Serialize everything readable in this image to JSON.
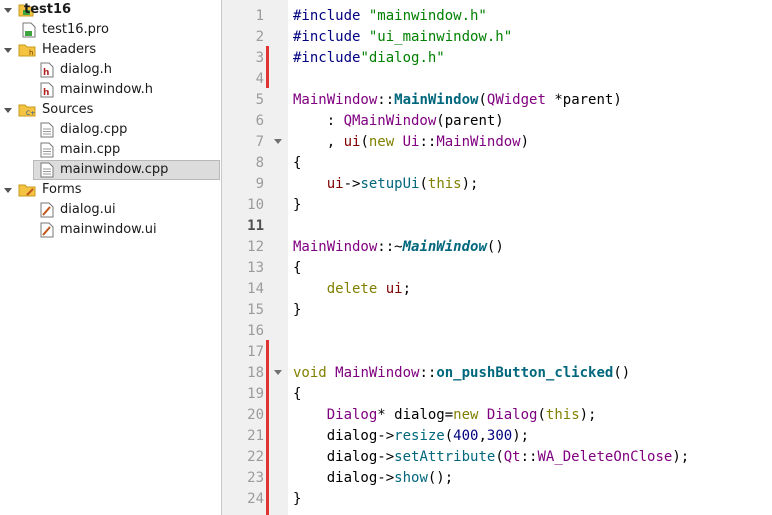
{
  "tree": {
    "project": "test16",
    "pro_file": "test16.pro",
    "headers": {
      "label": "Headers",
      "files": [
        "dialog.h",
        "mainwindow.h"
      ]
    },
    "sources": {
      "label": "Sources",
      "files": [
        "dialog.cpp",
        "main.cpp",
        "mainwindow.cpp"
      ]
    },
    "forms": {
      "label": "Forms",
      "files": [
        "dialog.ui",
        "mainwindow.ui"
      ]
    },
    "selected_file": "mainwindow.cpp"
  },
  "editor": {
    "current_line": 11,
    "line_numbers": [
      "1",
      "2",
      "3",
      "4",
      "5",
      "6",
      "7",
      "8",
      "9",
      "10",
      "11",
      "12",
      "13",
      "14",
      "15",
      "16",
      "17",
      "18",
      "19",
      "20",
      "21",
      "22",
      "23",
      "24"
    ],
    "lines": [
      {
        "t": [
          [
            "pp",
            "#include "
          ],
          [
            "str",
            "\"mainwindow.h\""
          ]
        ]
      },
      {
        "t": [
          [
            "pp",
            "#include "
          ],
          [
            "str",
            "\"ui_mainwindow.h\""
          ]
        ]
      },
      {
        "t": [
          [
            "pp",
            "#include"
          ],
          [
            "str",
            "\"dialog.h\""
          ]
        ]
      },
      {
        "t": []
      },
      {
        "t": [
          [
            "ty",
            "MainWindow"
          ],
          [
            "",
            "::"
          ],
          [
            "fnb",
            "MainWindow"
          ],
          [
            "",
            "("
          ],
          [
            "ty",
            "QWidget"
          ],
          [
            "",
            " *parent)"
          ]
        ]
      },
      {
        "t": [
          [
            "",
            "    : "
          ],
          [
            "ty",
            "QMainWindow"
          ],
          [
            "",
            "(parent)"
          ]
        ]
      },
      {
        "t": [
          [
            "",
            "    , "
          ],
          [
            "mem",
            "ui"
          ],
          [
            "",
            "("
          ],
          [
            "kw",
            "new"
          ],
          [
            "",
            " "
          ],
          [
            "ty",
            "Ui"
          ],
          [
            "",
            "::"
          ],
          [
            "ty",
            "MainWindow"
          ],
          [
            "",
            ")"
          ]
        ]
      },
      {
        "t": [
          [
            "",
            "{"
          ]
        ]
      },
      {
        "t": [
          [
            "",
            "    "
          ],
          [
            "mem",
            "ui"
          ],
          [
            "",
            "->"
          ],
          [
            "fn",
            "setupUi"
          ],
          [
            "",
            "("
          ],
          [
            "kw",
            "this"
          ],
          [
            "",
            ");"
          ]
        ]
      },
      {
        "t": [
          [
            "",
            "}"
          ]
        ]
      },
      {
        "t": []
      },
      {
        "t": [
          [
            "ty",
            "MainWindow"
          ],
          [
            "",
            "::~"
          ],
          [
            "fni",
            "MainWindow"
          ],
          [
            "",
            "()"
          ]
        ]
      },
      {
        "t": [
          [
            "",
            "{"
          ]
        ]
      },
      {
        "t": [
          [
            "",
            "    "
          ],
          [
            "kw",
            "delete"
          ],
          [
            "",
            " "
          ],
          [
            "mem",
            "ui"
          ],
          [
            "",
            ";"
          ]
        ]
      },
      {
        "t": [
          [
            "",
            "}"
          ]
        ]
      },
      {
        "t": []
      },
      {
        "t": []
      },
      {
        "t": [
          [
            "kw",
            "void"
          ],
          [
            "",
            " "
          ],
          [
            "ty",
            "MainWindow"
          ],
          [
            "",
            "::"
          ],
          [
            "fnb",
            "on_pushButton_clicked"
          ],
          [
            "",
            "()"
          ]
        ]
      },
      {
        "t": [
          [
            "",
            "{"
          ]
        ]
      },
      {
        "t": [
          [
            "",
            "    "
          ],
          [
            "ty",
            "Dialog"
          ],
          [
            "",
            "* dialog="
          ],
          [
            "kw",
            "new"
          ],
          [
            "",
            " "
          ],
          [
            "ty",
            "Dialog"
          ],
          [
            "",
            "("
          ],
          [
            "kw",
            "this"
          ],
          [
            "",
            ");"
          ]
        ]
      },
      {
        "t": [
          [
            "",
            "    dialog->"
          ],
          [
            "fn",
            "resize"
          ],
          [
            "",
            "("
          ],
          [
            "num",
            "400"
          ],
          [
            "",
            ","
          ],
          [
            "num",
            "300"
          ],
          [
            "",
            ");"
          ]
        ]
      },
      {
        "t": [
          [
            "",
            "    dialog->"
          ],
          [
            "fn",
            "setAttribute"
          ],
          [
            "",
            "("
          ],
          [
            "ty",
            "Qt"
          ],
          [
            "",
            "::"
          ],
          [
            "en",
            "WA_DeleteOnClose"
          ],
          [
            "",
            ");"
          ]
        ]
      },
      {
        "t": [
          [
            "",
            "    dialog->"
          ],
          [
            "fn",
            "show"
          ],
          [
            "",
            "();"
          ]
        ]
      },
      {
        "t": [
          [
            "",
            "}"
          ]
        ]
      }
    ]
  },
  "colors": {
    "change_marker": "#e23333",
    "selection": "#dcdcdc",
    "gutter": "#f0f0f0"
  },
  "icons": [
    "project-icon",
    "pro-file-icon",
    "folder-icon",
    "header-file-icon",
    "cpp-file-icon",
    "ui-file-icon",
    "expand-arrow-icon",
    "fold-arrow-icon"
  ]
}
